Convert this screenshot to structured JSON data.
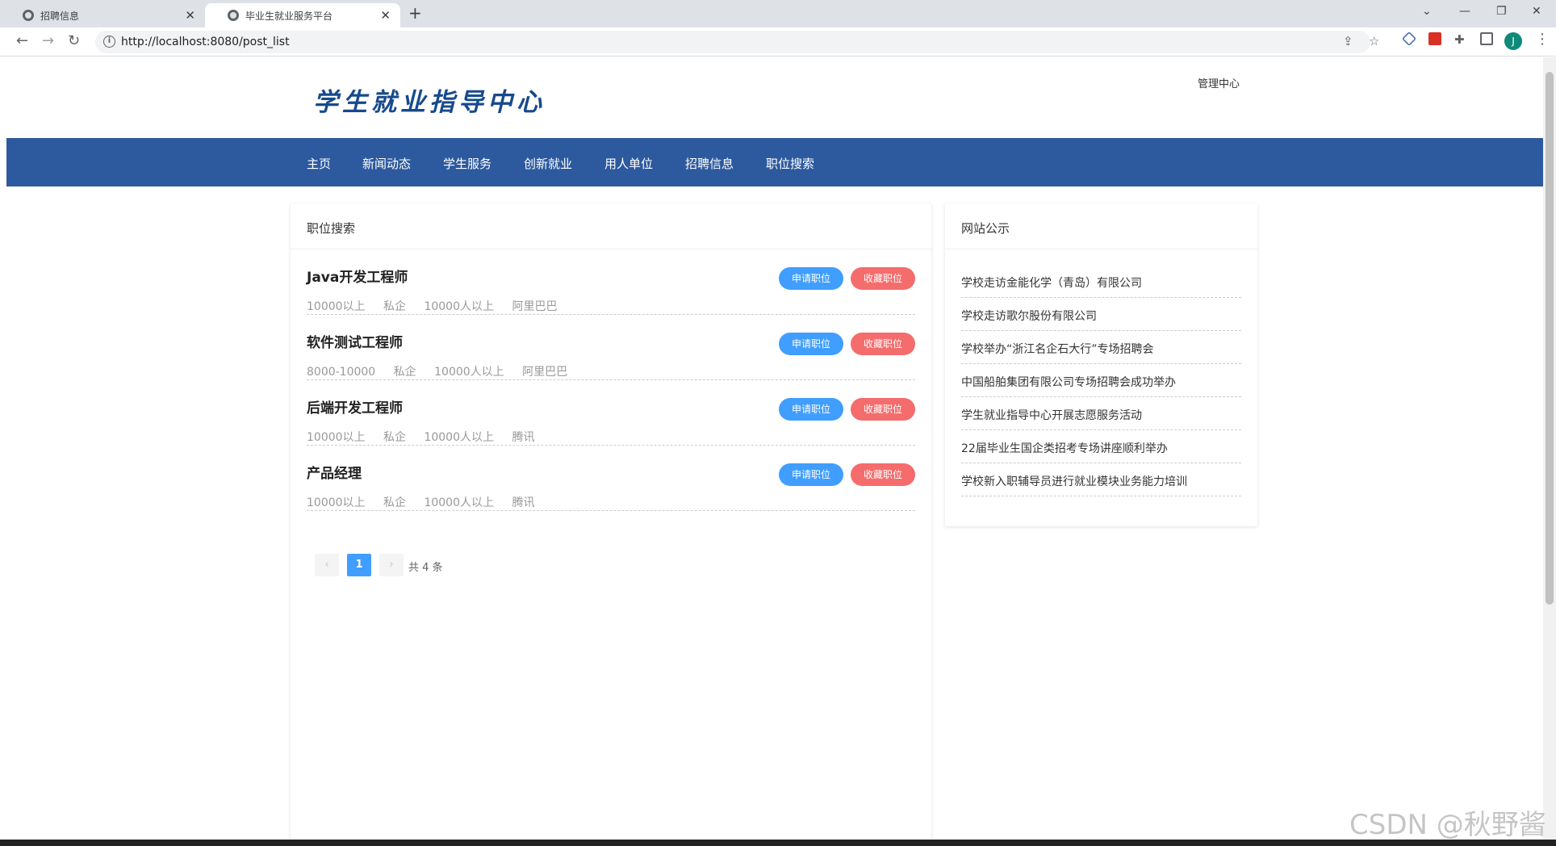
{
  "browser": {
    "tabs": [
      {
        "label": "招聘信息",
        "close": "✕"
      },
      {
        "label": "毕业生就业服务平台",
        "close": "✕"
      }
    ],
    "new_tab": "+",
    "url": "http://localhost:8080/post_list",
    "avatar_letter": "J"
  },
  "header": {
    "logo": "学生就业指导中心",
    "admin_link": "管理中心"
  },
  "nav": {
    "items": [
      "主页",
      "新闻动态",
      "学生服务",
      "创新就业",
      "用人单位",
      "招聘信息",
      "职位搜索"
    ]
  },
  "jobs_panel": {
    "title": "职位搜索",
    "apply_label": "申请职位",
    "fav_label": "收藏职位",
    "jobs": [
      {
        "title": "Java开发工程师",
        "salary": "10000以上",
        "type": "私企",
        "size": "10000人以上",
        "company": "阿里巴巴"
      },
      {
        "title": "软件测试工程师",
        "salary": "8000-10000",
        "type": "私企",
        "size": "10000人以上",
        "company": "阿里巴巴"
      },
      {
        "title": "后端开发工程师",
        "salary": "10000以上",
        "type": "私企",
        "size": "10000人以上",
        "company": "腾讯"
      },
      {
        "title": "产品经理",
        "salary": "10000以上",
        "type": "私企",
        "size": "10000人以上",
        "company": "腾讯"
      }
    ],
    "pagination": {
      "prev": "‹",
      "current": "1",
      "next": "›",
      "total": "共 4 条"
    }
  },
  "notice_panel": {
    "title": "网站公示",
    "items": [
      "学校走访金能化学（青岛）有限公司",
      "学校走访歌尔股份有限公司",
      "学校举办“浙江名企石大行”专场招聘会",
      "中国船舶集团有限公司专场招聘会成功举办",
      "学生就业指导中心开展志愿服务活动",
      "22届毕业生国企类招考专场讲座顺利举办",
      "学校新入职辅导员进行就业模块业务能力培训"
    ]
  },
  "watermark": "CSDN @秋野酱"
}
